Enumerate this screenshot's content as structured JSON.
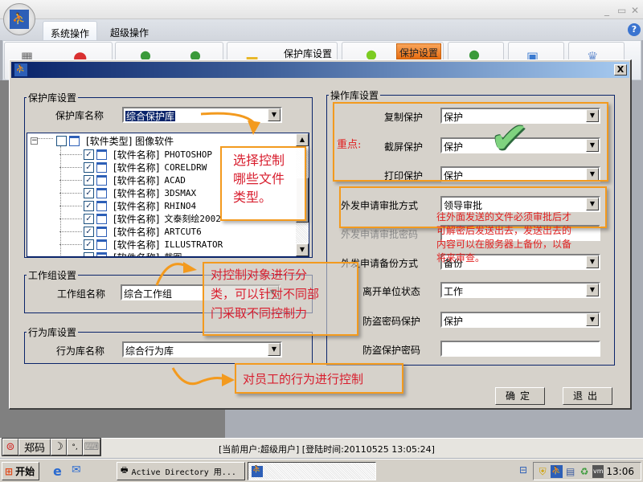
{
  "app": {
    "ribbon_tabs": [
      "系统操作",
      "超级操作"
    ],
    "active_tab": 0,
    "help_icon": "?",
    "ribbon_labels": {
      "protect_lib_settings": "保护库设置",
      "protect_settings": "保护设置"
    }
  },
  "dialog": {
    "close_label": "X",
    "protect_lib": {
      "legend": "保护库设置",
      "name_label": "保护库名称",
      "name_value": "综合保护库"
    },
    "tree": {
      "root": {
        "label": "[软件类型] 图像软件",
        "checked": false
      },
      "children": [
        {
          "prefix": "[软件名称]",
          "name": "PHOTOSHOP",
          "checked": true
        },
        {
          "prefix": "[软件名称]",
          "name": "CORELDRW",
          "checked": true
        },
        {
          "prefix": "[软件名称]",
          "name": "ACAD",
          "checked": true
        },
        {
          "prefix": "[软件名称]",
          "name": "3DSMAX",
          "checked": true
        },
        {
          "prefix": "[软件名称]",
          "name": "RHINO4",
          "checked": true
        },
        {
          "prefix": "[软件名称]",
          "name": "文泰刻绘2002",
          "checked": true
        },
        {
          "prefix": "[软件名称]",
          "name": "ARTCUT6",
          "checked": true
        },
        {
          "prefix": "[软件名称]",
          "name": "ILLUSTRATOR",
          "checked": true
        },
        {
          "prefix": "[软件名称]",
          "name": "截图",
          "checked": false
        }
      ]
    },
    "workgroup": {
      "legend": "工作组设置",
      "name_label": "工作组名称",
      "name_value": "综合工作组"
    },
    "behavior": {
      "legend": "行为库设置",
      "name_label": "行为库名称",
      "name_value": "综合行为库"
    },
    "operation": {
      "legend": "操作库设置",
      "fields": [
        {
          "label": "复制保护",
          "value": "保护"
        },
        {
          "label": "截屏保护",
          "value": "保护"
        },
        {
          "label": "打印保护",
          "value": "保护"
        },
        {
          "label": "外发申请审批方式",
          "value": "领导审批"
        },
        {
          "label": "外发申请审批密码",
          "value": ""
        },
        {
          "label": "外发申请备份方式",
          "value": "备份"
        },
        {
          "label": "离开单位状态",
          "value": "工作"
        },
        {
          "label": "防盗密码保护",
          "value": "保护"
        },
        {
          "label": "防盗保护密码",
          "value": ""
        }
      ]
    },
    "ok_label": "确定",
    "exit_label": "退出"
  },
  "annotations": {
    "keypoint": "重点:",
    "select_types": "选择控制哪些文件类型。",
    "select_types_lines": [
      "选择控制",
      "哪些文件",
      "类型。"
    ],
    "classify_lines": [
      "对控制对象进行分",
      "类，可以针对不同部",
      "门采取不同控制力"
    ],
    "behavior_note": "对员工的行为进行控制",
    "outbound_lines": [
      "往外面发送的文件必须审批后才",
      "可解密后发送出去，发送出去的",
      "内容可以在服务器上备份，以备",
      "将来审查。"
    ]
  },
  "statusbar": {
    "ime_label": "郑码",
    "status_text": "[当前用户:超级用户] [登陆时间:20110525 13:05:24]"
  },
  "taskbar": {
    "start_label": "开始",
    "tasks": [
      "Active Directory 用...",
      ""
    ],
    "clock": "13:06"
  }
}
